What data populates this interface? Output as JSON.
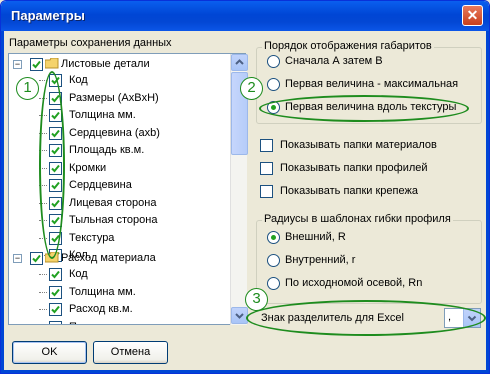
{
  "window": {
    "title": "Параметры",
    "close_glyph": "✕"
  },
  "left": {
    "title": "Параметры сохранения данных",
    "tree": {
      "group1": {
        "label": "Листовые детали",
        "items": [
          "Код",
          "Размеры (AxBxH)",
          "Толщина мм.",
          "Сердцевина (axb)",
          "Площадь кв.м.",
          "Кромки",
          "Сердцевина",
          "Лицевая сторона",
          "Тыльная сторона",
          "Текстура",
          "Кол."
        ]
      },
      "group2": {
        "label": "Расход материала",
        "items": [
          "Код",
          "Толщина мм.",
          "Расход кв.м.",
          "Примечание"
        ]
      }
    }
  },
  "order_group": {
    "title": "Порядок отображения габаритов",
    "options": [
      "Сначала А затем В",
      "Первая величина - максимальная",
      "Первая величина вдоль текстуры"
    ],
    "selected_index": 2
  },
  "show_options": [
    "Показывать папки материалов",
    "Показывать папки профилей",
    "Показывать папки крепежа"
  ],
  "radius_group": {
    "title": "Радиусы в шаблонах гибки профиля",
    "options": [
      "Внешний, R",
      "Внутренний, r",
      "По исходномой осевой, Rn"
    ],
    "selected_index": 0
  },
  "separator": {
    "label": "Знак разделитель для Excel",
    "value": ","
  },
  "buttons": {
    "ok": "OK",
    "cancel": "Отмена"
  },
  "annotations": [
    "1",
    "2",
    "3"
  ],
  "colors": {
    "annotation": "#1E8C1E",
    "title_bar": "#0046D5",
    "radio_dot": "#21A121"
  }
}
